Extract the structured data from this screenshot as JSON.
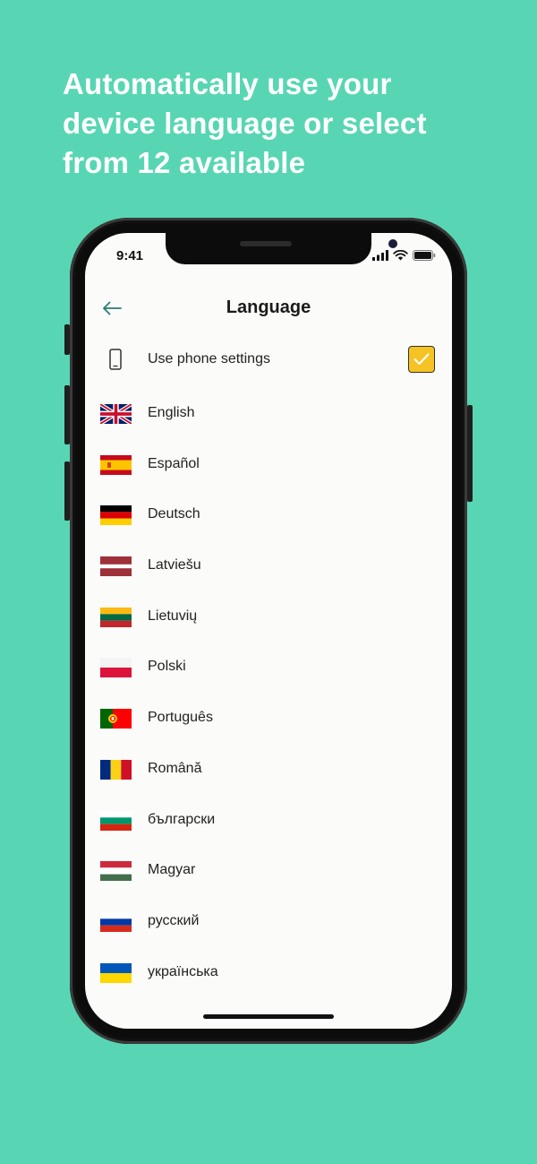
{
  "headline": "Automatically use your device language or select from 12 available",
  "status_bar": {
    "time": "9:41"
  },
  "nav": {
    "title": "Language",
    "back_icon": "arrow-left-icon"
  },
  "phone_settings": {
    "label": "Use phone settings",
    "checked": true,
    "icon": "smartphone-icon"
  },
  "accent_colors": {
    "background": "#58d6b4",
    "checkbox": "#f6c324",
    "back_arrow": "#2a7d74"
  },
  "languages": [
    {
      "label": "English",
      "flag": "uk-flag-icon"
    },
    {
      "label": "Español",
      "flag": "spain-flag-icon"
    },
    {
      "label": "Deutsch",
      "flag": "germany-flag-icon"
    },
    {
      "label": "Latviešu",
      "flag": "latvia-flag-icon"
    },
    {
      "label": "Lietuvių",
      "flag": "lithuania-flag-icon"
    },
    {
      "label": "Polski",
      "flag": "poland-flag-icon"
    },
    {
      "label": "Português",
      "flag": "portugal-flag-icon"
    },
    {
      "label": "Română",
      "flag": "romania-flag-icon"
    },
    {
      "label": "български",
      "flag": "bulgaria-flag-icon"
    },
    {
      "label": "Magyar",
      "flag": "hungary-flag-icon"
    },
    {
      "label": "русский",
      "flag": "russia-flag-icon"
    },
    {
      "label": "українська",
      "flag": "ukraine-flag-icon"
    }
  ]
}
